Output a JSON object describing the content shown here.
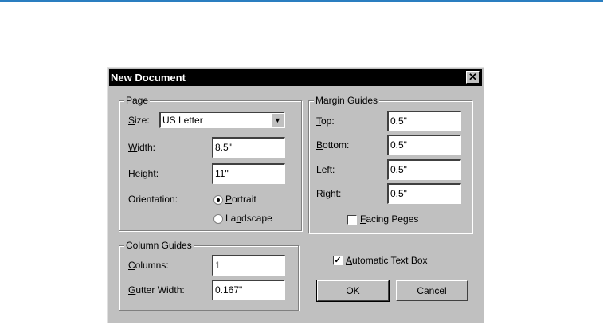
{
  "dialog": {
    "title": "New Document",
    "close_symbol": "✕",
    "page_group": {
      "legend": "Page",
      "size_label_u": "S",
      "size_label_rest": "ize:",
      "size_value": "US Letter",
      "width_label_u": "W",
      "width_label_rest": "idth:",
      "width_value": "8.5\"",
      "height_label_u": "H",
      "height_label_rest": "eight:",
      "height_value": "11\"",
      "orientation_label": "Orientation:",
      "portrait_u": "P",
      "portrait_rest": "ortrait",
      "landscape_pre": "La",
      "landscape_u": "n",
      "landscape_rest": "dscape",
      "orientation_selected": "portrait"
    },
    "margin_group": {
      "legend": "Margin Guides",
      "top_u": "T",
      "top_rest": "op:",
      "top_value": "0.5\"",
      "bottom_u": "B",
      "bottom_rest": "ottom:",
      "bottom_value": "0.5\"",
      "left_u": "L",
      "left_rest": "eft:",
      "left_value": "0.5\"",
      "right_u": "R",
      "right_rest": "ight:",
      "right_value": "0.5\"",
      "facing_u": "F",
      "facing_rest": "acing Peges",
      "facing_checked": false
    },
    "column_group": {
      "legend": "Column Guides",
      "columns_u": "C",
      "columns_rest": "olumns:",
      "columns_value": "1",
      "gutter_u": "G",
      "gutter_rest": "utter Width:",
      "gutter_value": "0.167\""
    },
    "auto_text_box": {
      "u": "A",
      "rest": "utomatic Text Box",
      "checked": true,
      "check_symbol": "✓"
    },
    "ok_label": "OK",
    "cancel_label": "Cancel"
  }
}
